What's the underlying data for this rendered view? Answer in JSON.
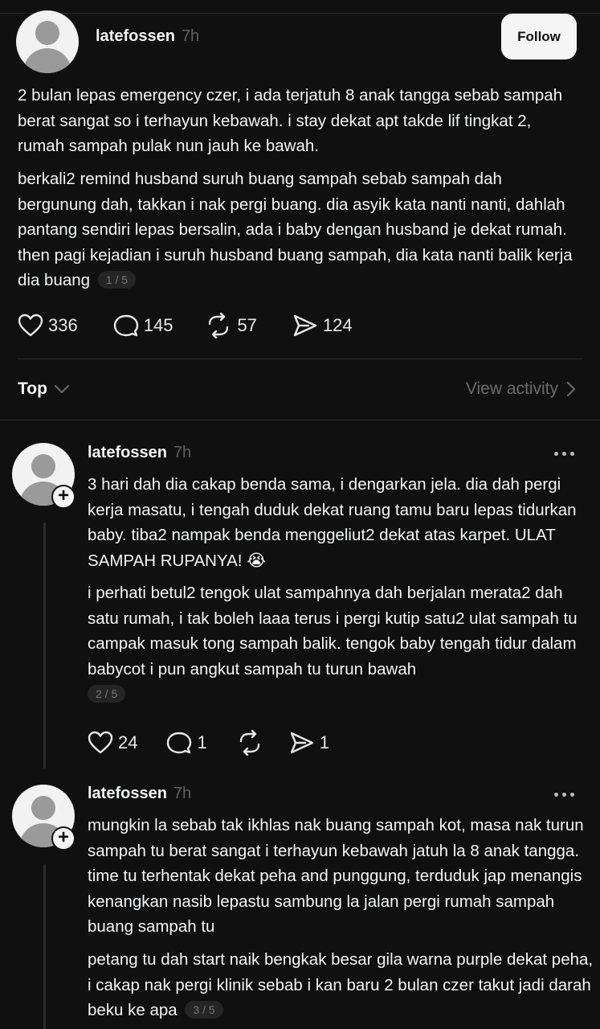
{
  "main_post": {
    "username": "latefossen",
    "time": "7h",
    "follow_label": "Follow",
    "paragraph1": "2 bulan lepas emergency czer, i ada terjatuh 8 anak tangga sebab sampah berat sangat so i terhayun kebawah. i stay dekat apt takde lif tingkat 2, rumah sampah pulak nun jauh ke bawah.",
    "paragraph2": "berkali2 remind husband suruh buang sampah sebab sampah dah bergunung dah, takkan i nak pergi buang. dia asyik kata nanti nanti, dahlah pantang sendiri lepas bersalin, ada i baby dengan husband je dekat rumah. then pagi kejadian i suruh husband buang sampah, dia kata nanti balik kerja dia buang",
    "page_indicator": "1 / 5",
    "likes": "336",
    "comments": "145",
    "reposts": "57",
    "shares": "124"
  },
  "sort_bar": {
    "sort_label": "Top",
    "view_activity_label": "View activity"
  },
  "replies": [
    {
      "username": "latefossen",
      "time": "7h",
      "paragraph1": "3 hari dah dia cakap benda sama, i dengarkan jela. dia dah pergi kerja masatu, i tengah duduk dekat ruang tamu baru lepas tidurkan baby. tiba2 nampak benda menggeliut2 dekat atas karpet. ULAT SAMPAH RUPANYA! 😭",
      "paragraph2": "i perhati betul2 tengok ulat sampahnya dah berjalan merata2 dah satu rumah, i tak boleh laaa terus i pergi kutip satu2 ulat sampah tu campak masuk tong sampah balik. tengok baby tengah tidur dalam babycot i pun angkut sampah tu turun bawah",
      "page_indicator": "2 / 5",
      "likes": "24",
      "comments": "1",
      "reposts": "",
      "shares": "1"
    },
    {
      "username": "latefossen",
      "time": "7h",
      "paragraph1": "mungkin la sebab tak ikhlas nak buang sampah kot, masa nak turun sampah tu berat sangat i terhayun kebawah jatuh la 8 anak tangga. time tu terhentak dekat peha and punggung, terduduk jap menangis kenangkan nasib lepastu sambung la jalan pergi rumah sampah buang sampah tu",
      "paragraph2": "petang tu dah start naik bengkak besar gila warna purple dekat peha, i cakap nak pergi klinik sebab i kan baru 2 bulan czer takut jadi darah beku ke apa",
      "page_indicator": "3 / 5"
    }
  ],
  "colors": {
    "background": "#101010",
    "text": "#f3f5f7",
    "muted": "#6b6b6b",
    "follow_bg": "#f5f5f5"
  }
}
